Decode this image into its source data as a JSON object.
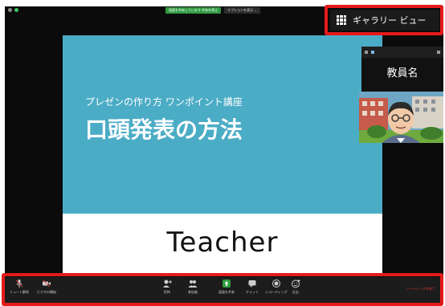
{
  "top_bar": {
    "share_status": "画面を共有しています 共有を停止",
    "options": "オプションを表示 ⌄"
  },
  "view_button": {
    "label": "ギャラリー ビュー"
  },
  "slide": {
    "subtitle": "プレゼンの作り方 ワンポイント講座",
    "title": "口頭発表の方法"
  },
  "presenter": {
    "name": "教員名"
  },
  "caption": "Teacher",
  "toolbar": {
    "mute": "ミュート解除",
    "video": "ビデオの開始",
    "security": "招待",
    "participants": "参加者",
    "share": "画面を共有",
    "chat": "チャット",
    "record": "レコーディング",
    "reactions": "反応",
    "end": "ミーティングを終了"
  },
  "colors": {
    "slide_bg": "#4bacc6",
    "highlight": "#e51a1a",
    "share_green": "#2f9a3f",
    "end_red": "#e23b3b"
  }
}
